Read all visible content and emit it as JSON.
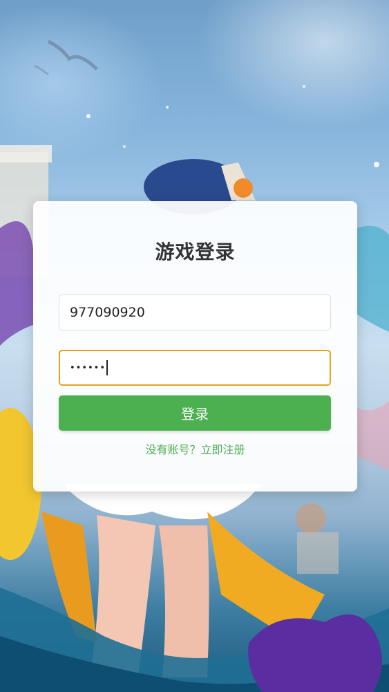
{
  "form": {
    "title": "游戏登录",
    "username_value": "977090920",
    "password_masked": "••••••",
    "login_label": "登录",
    "register_link": "没有账号？立即注册"
  },
  "colors": {
    "accent": "#4caf50",
    "focus_border": "#e8a317",
    "title_text": "#333333"
  },
  "icons": {
    "background": "game-character-illustration"
  }
}
